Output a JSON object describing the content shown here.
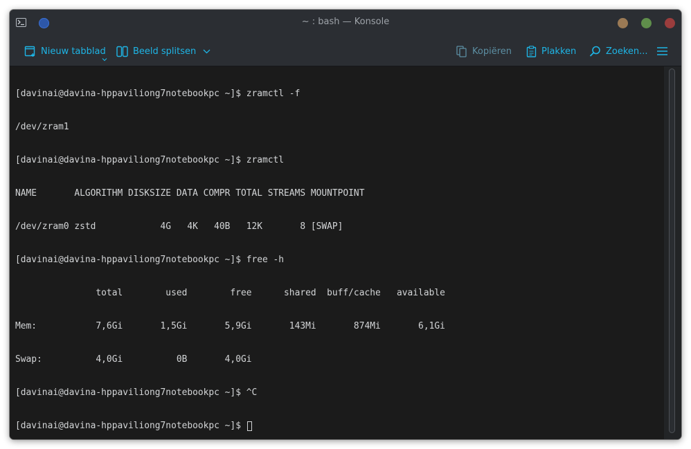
{
  "window": {
    "title": "~ : bash — Konsole"
  },
  "toolbar": {
    "new_tab_label": "Nieuw tabblad",
    "split_view_label": "Beeld splitsen",
    "copy_label": "Kopiëren",
    "paste_label": "Plakken",
    "search_label": "Zoeken...",
    "accent_color": "#1eb5e6"
  },
  "terminal": {
    "lines": [
      "[davinai@davina-hppaviliong7notebookpc ~]$ zramctl -f",
      "/dev/zram1",
      "[davinai@davina-hppaviliong7notebookpc ~]$ zramctl",
      "NAME       ALGORITHM DISKSIZE DATA COMPR TOTAL STREAMS MOUNTPOINT",
      "/dev/zram0 zstd            4G   4K   40B   12K       8 [SWAP]",
      "[davinai@davina-hppaviliong7notebookpc ~]$ free -h",
      "               total        used        free      shared  buff/cache   available",
      "Mem:           7,6Gi       1,5Gi       5,9Gi       143Mi       874Mi       6,1Gi",
      "Swap:          4,0Gi          0B       4,0Gi",
      "[davinai@davina-hppaviliong7notebookpc ~]$ ^C"
    ],
    "prompt": "[davinai@davina-hppaviliong7notebookpc ~]$ ",
    "background_color": "#1b1b1b",
    "text_color": "#d3d5d7"
  }
}
